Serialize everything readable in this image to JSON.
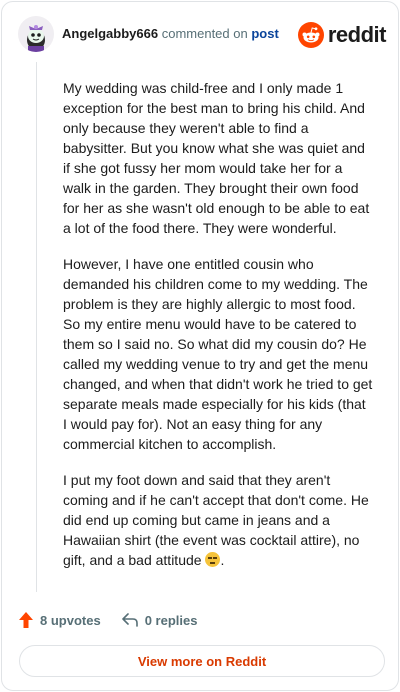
{
  "header": {
    "username": "Angelgabby666",
    "action_text": "commented on",
    "post_link": "post",
    "brand_word": "reddit",
    "avatar_icon": "snoo-avatar-icon",
    "brand_icon": "reddit-logo-icon"
  },
  "comment": {
    "paragraphs": [
      "My wedding was child-free and I only made 1 exception for the best man to bring his child. And only because they weren't able to find a babysitter. But you know what she was quiet and if she got fussy her mom would take her for a walk in the garden. They brought their own food for her as she wasn't old enough to be able to eat a lot of the food there. They were wonderful.",
      "However, I have one entitled cousin who demanded his children come to my wedding. The problem is they are highly allergic to most food. So my entire menu would have to be catered to them so I said no. So what did my cousin do? He called my wedding venue to try and get the menu changed, and when that didn't work he tried to get separate meals made especially for his kids (that I would pay for). Not an easy thing for any commercial kitchen to accomplish.",
      "I put my foot down and said that they aren't coming and if he can't accept that don't come. He did end up coming but came in jeans and a Hawaiian shirt (the event was cocktail attire), no gift, and a bad attitude"
    ],
    "emoji_icon": "unamused-face-emoji",
    "trailing_period": "."
  },
  "actions": {
    "upvotes": "8 upvotes",
    "replies": "0 replies",
    "upvote_icon": "upvote-arrow-icon",
    "reply_icon": "reply-arrow-icon"
  },
  "footer": {
    "view_more": "View more on Reddit"
  },
  "colors": {
    "accent": "#d93a00",
    "upvote": "#ff4500",
    "link": "#0a449b",
    "muted": "#576f76",
    "border": "#e0e3e6"
  }
}
